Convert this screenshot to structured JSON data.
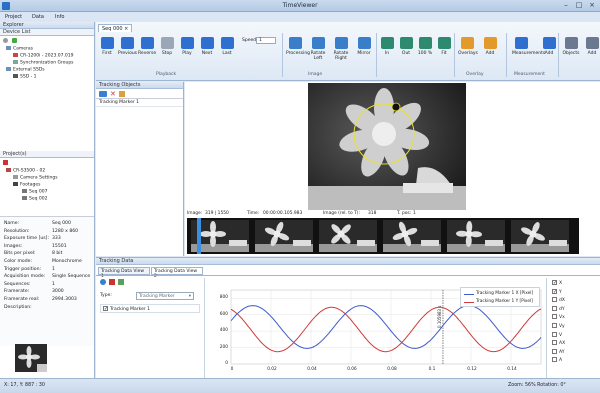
{
  "app": {
    "title": "TimeViewer"
  },
  "menu": [
    "Project",
    "Data",
    "Info"
  ],
  "explorer": {
    "title": "Explorer",
    "device_list": "Device List",
    "devices": [
      "Cameras",
      "CR-1200i - 2023.07.019",
      "Synchronization Groups",
      "External SSDs",
      "SSD - 1"
    ],
    "project_title": "Project(s)",
    "project": [
      "CR-S3500 - 02",
      "Camera Settings",
      "Footages",
      "Seq 007",
      "Seq 002"
    ],
    "props": [
      [
        "Name:",
        "Seq 000"
      ],
      [
        "Resolution:",
        "1280 x 860"
      ],
      [
        "Exposure time [us]:",
        "333"
      ],
      [
        "Images:",
        "15501"
      ],
      [
        "Bits per pixel:",
        "8 bit"
      ],
      [
        "Color mode:",
        "Monochrome"
      ],
      [
        "Trigger position:",
        "1"
      ],
      [
        "Acquisition mode:",
        "Single Sequence"
      ],
      [
        "Sequences:",
        "1"
      ],
      [
        "Framerate:",
        "3000"
      ],
      [
        "Framerate real:",
        "2994.3003"
      ],
      [
        "Description:",
        ""
      ]
    ]
  },
  "ribbon": {
    "tab": "Seq 000",
    "playback": [
      "First",
      "Previous",
      "Reverse",
      "Stop",
      "Play",
      "Next",
      "Last"
    ],
    "speed_label": "Speed",
    "speed_value": "1",
    "image_btns": [
      "Processing",
      "Rotate Left",
      "Rotate Right",
      "Mirror"
    ],
    "zoom_btns": [
      "In",
      "Out",
      "100 %",
      "Fit"
    ],
    "overlay_btns": [
      "Overlays",
      "Add"
    ],
    "measure_btns": [
      "Measurements",
      "Add"
    ],
    "obj_btns": [
      "Objects",
      "Add"
    ],
    "groups": [
      "Playback",
      "Image",
      "Overlay",
      "Measurement"
    ]
  },
  "tracking_objects": {
    "title": "Tracking Objects",
    "item": "Tracking Marker 1"
  },
  "viewer": {
    "image": "Image:",
    "image_val": "319 | 1550",
    "time": "Time:",
    "time_val": "00:00:00.105.983",
    "rel": "Image (rel. to T):",
    "rel_val": "318",
    "tpos": "T. pos:",
    "tpos_val": "1"
  },
  "tracking_data": {
    "title": "Tracking Data",
    "tabs": [
      "Tracking Data View 1",
      "Tracking Data View 2"
    ],
    "type_label": "Type:",
    "type_value": "Tracking Marker",
    "item": "Tracking Marker 1",
    "legend": [
      "Tracking Marker 1 X [Pixel]",
      "Tracking Marker 1 Y [Pixel]"
    ],
    "yticks": [
      "800",
      "600",
      "400",
      "200",
      "0"
    ],
    "xticks": [
      "0",
      "0.02",
      "0.04",
      "0.06",
      "0.08",
      "0.1",
      "0.12",
      "0.14"
    ],
    "cursor": "0.105983 s",
    "channels": [
      "X",
      "Y",
      "dX",
      "dY",
      "Vx",
      "Vy",
      "V",
      "AX",
      "AY",
      "A"
    ],
    "checked": [
      true,
      true,
      false,
      false,
      false,
      false,
      false,
      false,
      false,
      false
    ]
  },
  "status": {
    "pos": "X: 17, Y: 887 : 30",
    "zoom": "Zoom: 56%  Rotation: 0°"
  },
  "colors": {
    "x_series": "#3b5bcc",
    "y_series": "#d03a3a"
  }
}
